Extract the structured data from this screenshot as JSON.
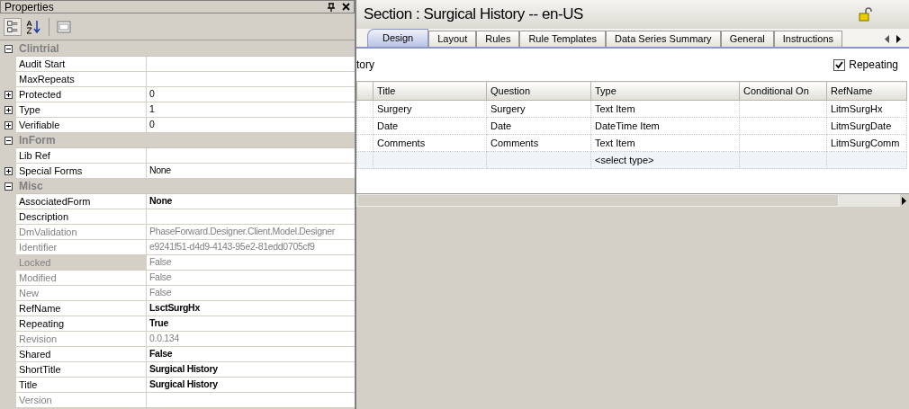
{
  "properties_panel": {
    "title": "Properties",
    "rows": [
      {
        "kind": "category",
        "name": "Clintrial",
        "expanded": true
      },
      {
        "kind": "property",
        "name": "Audit Start",
        "value": "",
        "expandable": false,
        "readonly": false,
        "selected": false
      },
      {
        "kind": "property",
        "name": "MaxRepeats",
        "value": "",
        "expandable": false,
        "readonly": false,
        "selected": false
      },
      {
        "kind": "property",
        "name": "Protected",
        "value": "0",
        "expandable": true,
        "readonly": false,
        "bold": false,
        "selected": false
      },
      {
        "kind": "property",
        "name": "Type",
        "value": "1",
        "expandable": true,
        "readonly": false,
        "bold": false,
        "selected": false
      },
      {
        "kind": "property",
        "name": "Verifiable",
        "value": "0",
        "expandable": true,
        "readonly": false,
        "bold": false,
        "selected": false
      },
      {
        "kind": "category",
        "name": "InForm",
        "expanded": true
      },
      {
        "kind": "property",
        "name": "Lib Ref",
        "value": "",
        "expandable": false,
        "readonly": false,
        "selected": false
      },
      {
        "kind": "property",
        "name": "Special Forms",
        "value": "None",
        "expandable": true,
        "readonly": false,
        "bold": false,
        "selected": false
      },
      {
        "kind": "category",
        "name": "Misc",
        "expanded": true
      },
      {
        "kind": "property",
        "name": "AssociatedForm",
        "value": "None",
        "expandable": false,
        "readonly": false,
        "bold": true,
        "selected": false
      },
      {
        "kind": "property",
        "name": "Description",
        "value": "",
        "expandable": false,
        "readonly": false,
        "selected": false
      },
      {
        "kind": "property",
        "name": "DmValidation",
        "value": "PhaseForward.Designer.Client.Model.Designer",
        "expandable": false,
        "readonly": true,
        "bold": false,
        "selected": false
      },
      {
        "kind": "property",
        "name": "Identifier",
        "value": "e9241f51-d4d9-4143-95e2-81edd0705cf9",
        "expandable": false,
        "readonly": true,
        "bold": false,
        "selected": false
      },
      {
        "kind": "property",
        "name": "Locked",
        "value": "False",
        "expandable": false,
        "readonly": true,
        "bold": false,
        "selected": true
      },
      {
        "kind": "property",
        "name": "Modified",
        "value": "False",
        "expandable": false,
        "readonly": true,
        "bold": false,
        "selected": false
      },
      {
        "kind": "property",
        "name": "New",
        "value": "False",
        "expandable": false,
        "readonly": true,
        "bold": false,
        "selected": false
      },
      {
        "kind": "property",
        "name": "RefName",
        "value": "LsctSurgHx",
        "expandable": false,
        "readonly": false,
        "bold": true,
        "selected": false
      },
      {
        "kind": "property",
        "name": "Repeating",
        "value": "True",
        "expandable": false,
        "readonly": false,
        "bold": true,
        "selected": false
      },
      {
        "kind": "property",
        "name": "Revision",
        "value": "0.0.134",
        "expandable": false,
        "readonly": true,
        "bold": false,
        "selected": false
      },
      {
        "kind": "property",
        "name": "Shared",
        "value": "False",
        "expandable": false,
        "readonly": false,
        "bold": true,
        "selected": false
      },
      {
        "kind": "property",
        "name": "ShortTitle",
        "value": "Surgical History",
        "expandable": false,
        "readonly": false,
        "bold": true,
        "selected": false
      },
      {
        "kind": "property",
        "name": "Title",
        "value": "Surgical History",
        "expandable": false,
        "readonly": false,
        "bold": true,
        "selected": false
      },
      {
        "kind": "property",
        "name": "Version",
        "value": "",
        "expandable": false,
        "readonly": true,
        "selected": false
      }
    ]
  },
  "section": {
    "title": "Section : Surgical History -- en-US",
    "tabs": [
      {
        "label": "Design",
        "selected": true
      },
      {
        "label": "Layout",
        "selected": false
      },
      {
        "label": "Rules",
        "selected": false
      },
      {
        "label": "Rule Templates",
        "selected": false
      },
      {
        "label": "Data Series Summary",
        "selected": false
      },
      {
        "label": "General",
        "selected": false
      },
      {
        "label": "Instructions",
        "selected": false
      }
    ],
    "partial_label": "tory",
    "repeating": {
      "label": "Repeating",
      "checked": true
    },
    "table": {
      "columns": [
        "Title",
        "Question",
        "Type",
        "Conditional On",
        "RefName"
      ],
      "rows": [
        [
          "Surgery",
          "Surgery",
          "Text Item",
          "",
          "LitmSurgHx"
        ],
        [
          "Date",
          "Date",
          "DateTime Item",
          "",
          "LitmSurgDate"
        ],
        [
          "Comments",
          "Comments",
          "Text Item",
          "",
          "LitmSurgComm"
        ]
      ],
      "new_row": {
        "type": "<select type>"
      }
    }
  }
}
